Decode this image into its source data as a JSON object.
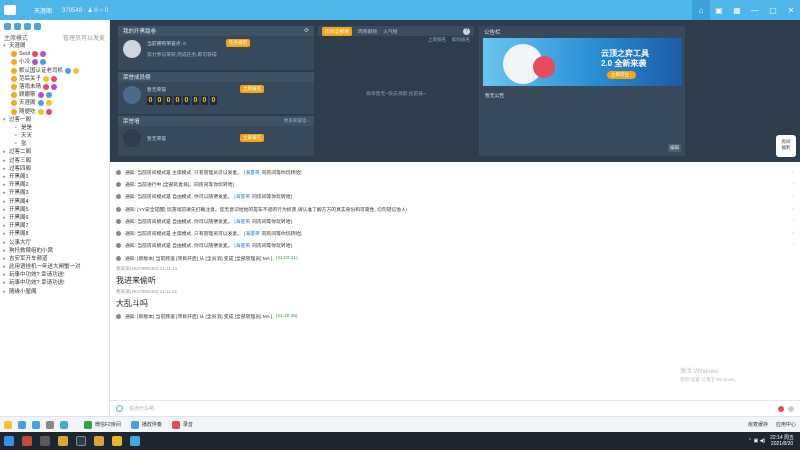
{
  "titlebar": {
    "title": "天涯阁",
    "meta": "370548 ·  ♟ 0   ○ 0",
    "buttons": [
      "⌂",
      "▣",
      "▦",
      "—",
      "▢",
      "✕"
    ]
  },
  "sidebar": {
    "mode": "主席模式",
    "mode_link": "管理员可以发麦",
    "groups": [
      {
        "label": "天涯阁",
        "members": [
          "Soul",
          "小冷",
          "默认国认证老司机",
          "范后关子",
          "落雨未晴",
          "顾娜斯",
          "天涯阁",
          "随便吃"
        ]
      },
      {
        "label": "过客一阁",
        "children": [
          "是是",
          "天天",
          "张"
        ]
      },
      {
        "label": "过客二阁"
      },
      {
        "label": "过客三阁"
      },
      {
        "label": "过客四阁"
      },
      {
        "label": "开黑阁1"
      },
      {
        "label": "开黑阁2"
      },
      {
        "label": "开黑阁3"
      },
      {
        "label": "开黑阁4"
      },
      {
        "label": "开黑阁5"
      },
      {
        "label": "开黑阁6"
      },
      {
        "label": "开黑阁7"
      },
      {
        "label": "开黑阁8"
      },
      {
        "label": "公事大厅"
      },
      {
        "label": "狗托救赎组的小窝"
      },
      {
        "label": "吉安军开车频道"
      },
      {
        "label": "此用语挂机一年送大闸蟹一对"
      },
      {
        "label": "玩事中功效? 幸请功送!"
      },
      {
        "label": "玩事中功效? 幸请功送!"
      },
      {
        "label": "随缘小屋阁"
      }
    ]
  },
  "tasks": {
    "title": "我的开黑踏卷",
    "welcome": "当前拥有荣誉点: 0",
    "welcome_btn": "任务规则",
    "desc": "努力参与荣获,完成任务,即可获得",
    "rank_title": "荣誉成员榜",
    "rank_name": "暂无荣誉",
    "rank_btn": "立即报名",
    "digits": [
      "0",
      "0",
      "0",
      "0",
      "0",
      "0",
      "0",
      "0"
    ],
    "honor_title": "荣誉墙",
    "honor_link": "更多荣誉墙 ›",
    "honor_name": "暂无荣誉",
    "honor_btn": "立即报名"
  },
  "ranking": {
    "tab_active": "房间全部榜",
    "tab2": "周贡献榜",
    "tab3": "人气榜",
    "sub1": "上周排名",
    "sub2": "如何排名",
    "empty": "榜单暂无~快去贡献,抢前排~"
  },
  "announce": {
    "title": "公告栏",
    "banner1": "云顶之弈工具",
    "banner2": "2.0 全新来袭",
    "banner3": "立即前往 ›",
    "none": "暂无公告",
    "more": "编辑"
  },
  "fuli": {
    "line1": "房间",
    "line2": "福利"
  },
  "chat": {
    "notices": [
      {
        "pre": "通知: 当前房间模式是 主席模式, 只有管理员可以发麦。",
        "kw": "[海量英",
        "post": "同房间等你玩转哈]"
      },
      {
        "pre": "通知: 当前进行中 [全部房麦排]。",
        "kw": "",
        "post": "同房间等你玩转哈]"
      },
      {
        "pre": "通知: 当前房间模式是 自由模式, 你可以随便发麦。",
        "kw": "[海量英",
        "post": "同房间等你玩转哈]"
      },
      {
        "pre": "通知: [YY安全提醒] 玩游戏前请先们确注意。您无意识地给的提车不适的行为损害,请认准了解方方的真实身份和可靠性, 切勿轻信他人!",
        "kw": "",
        "post": ""
      },
      {
        "pre": "通知: 当前房间模式是 自由模式, 你可以随便发麦。",
        "kw": "[海量英",
        "post": "同房间等你玩转哈]"
      },
      {
        "pre": "通知: 当前房间模式是 主席模式, 只有管理员可以发麦。",
        "kw": "[海量英",
        "post": "同房间等你玩转哈]"
      },
      {
        "pre": "通知: 当前房间模式是 自由模式, 你可以随便发麦。",
        "kw": "[海量英",
        "post": "同房间等你玩转哈]"
      }
    ],
    "join1": {
      "pre": "通知: [新版本] 当前频道 [项目开启] 从 [全员消] 变成 [全部管理员] MA ],",
      "time": "(21:03:21)"
    },
    "msg1": {
      "user": "我某某(2637895283)  21:11:14",
      "text": "我进来偷听"
    },
    "msg2": {
      "user": "我某某(2637895283)  21:11:51",
      "text": "大乱斗吗"
    },
    "join2": {
      "pre": "通知: [新版本] 当前频道 [项目开启] 从 [全员消] 变成 [全部管理员] MA ],",
      "time": "(21:38:35)"
    }
  },
  "input": {
    "placeholder": "说点什么吧..."
  },
  "watermark": {
    "line1": "激活 Windows",
    "line2": "转到\"设置\"以激活 Windows。"
  },
  "bottombar": {
    "btn1": "微信F2房间",
    "btn2": "播放伴奏",
    "btn3": "录音",
    "right1": "房麦缓存",
    "right2": "应用中心"
  },
  "taskbar": {
    "time": "22:14 周五",
    "date": "2021/8/20"
  }
}
